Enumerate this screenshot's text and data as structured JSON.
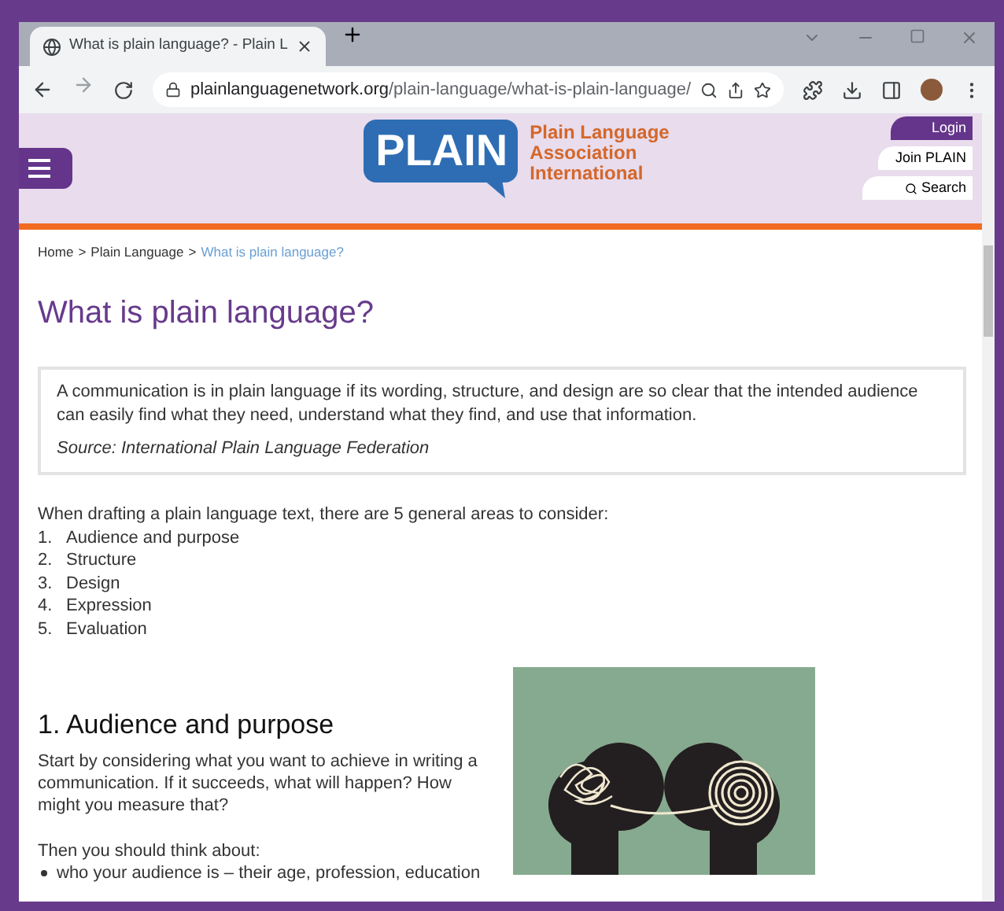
{
  "browser": {
    "tab_title": "What is plain language? - Plain L",
    "url_domain": "plainlanguagenetwork.org",
    "url_path": "/plain-language/what-is-plain-language/"
  },
  "header": {
    "logo_text": "PLAIN",
    "org_name": [
      "Plain Language",
      "Association",
      "International"
    ],
    "buttons": [
      {
        "label": "Login",
        "kind": "primary"
      },
      {
        "label": "Join PLAIN",
        "kind": "plain"
      },
      {
        "label": "Search",
        "kind": "search"
      }
    ]
  },
  "breadcrumb": [
    {
      "label": "Home",
      "current": false
    },
    {
      "label": "Plain Language",
      "current": false
    },
    {
      "label": "What is plain language?",
      "current": true
    }
  ],
  "breadcrumb_separator": ">",
  "title": "What is plain language?",
  "quote": {
    "text": "A communication is in plain language if its wording, structure, and design are so clear that the intended audience can easily find what they need, understand what they find, and use that information.",
    "source": "Source: International Plain Language Federation"
  },
  "intro": "When drafting a plain language text, there are 5 general areas to consider:",
  "areas": [
    {
      "number": "1.",
      "label": "Audience and purpose"
    },
    {
      "number": "2.",
      "label": "Structure"
    },
    {
      "number": "3.",
      "label": "Design"
    },
    {
      "number": "4.",
      "label": "Expression"
    },
    {
      "number": "5.",
      "label": "Evaluation"
    }
  ],
  "section": {
    "heading": "1. Audience and purpose",
    "paragraph": "Start by considering what you want to achieve in writing a communication. If it succeeds, what will happen? How might you measure that?",
    "lead": "Then you should think about:",
    "bullets": [
      "who your audience is – their age, profession, education"
    ]
  }
}
